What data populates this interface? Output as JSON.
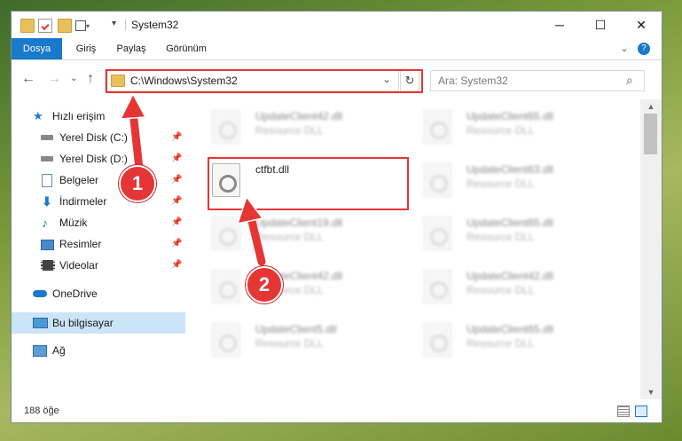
{
  "window": {
    "title": "System32",
    "minimize_icon": "─",
    "maximize_icon": "☐",
    "close_icon": "✕"
  },
  "ribbon": {
    "tabs": [
      "Dosya",
      "Giriş",
      "Paylaş",
      "Görünüm"
    ],
    "expand_icon": "⌄",
    "help_icon": "?"
  },
  "navigation": {
    "back_icon": "←",
    "forward_icon": "→",
    "recent_icon": "⌄",
    "up_icon": "↑",
    "address": "C:\\Windows\\System32",
    "dropdown_icon": "⌄",
    "refresh_icon": "↻",
    "search_placeholder": "Ara: System32",
    "search_icon": "⌕"
  },
  "sidebar": {
    "items": [
      {
        "label": "Hızlı erişim",
        "icon": "star-icon",
        "pinned": false
      },
      {
        "label": "Yerel Disk (C:)",
        "icon": "disk-icon",
        "pinned": true
      },
      {
        "label": "Yerel Disk (D:)",
        "icon": "disk-icon",
        "pinned": true
      },
      {
        "label": "Belgeler",
        "icon": "documents-icon",
        "pinned": true
      },
      {
        "label": "İndirmeler",
        "icon": "download-icon",
        "pinned": true
      },
      {
        "label": "Müzik",
        "icon": "music-icon",
        "pinned": true
      },
      {
        "label": "Resimler",
        "icon": "pictures-icon",
        "pinned": true
      },
      {
        "label": "Videolar",
        "icon": "videos-icon",
        "pinned": true
      },
      {
        "label": "OneDrive",
        "icon": "cloud-icon",
        "pinned": false
      },
      {
        "label": "Bu bilgisayar",
        "icon": "computer-icon",
        "pinned": false,
        "selected": true
      },
      {
        "label": "Ağ",
        "icon": "network-icon",
        "pinned": false
      }
    ],
    "pin_icon": "📌"
  },
  "files": [
    {
      "name": "UpdateClient42.dll",
      "type": "Resource DLL"
    },
    {
      "name": "UpdateClient65.dll",
      "type": "Resource DLL"
    },
    {
      "name": "ctfbt.dll",
      "type": ""
    },
    {
      "name": "UpdateClient63.dll",
      "type": "Resource DLL"
    },
    {
      "name": "UpdateClient19.dll",
      "type": "Resource DLL"
    },
    {
      "name": "UpdateClient65.dll",
      "type": "Resource DLL"
    },
    {
      "name": "UpdateClient42.dll",
      "type": "Resource DLL"
    },
    {
      "name": "UpdateClient42.dll",
      "type": "Resource DLL"
    },
    {
      "name": "UpdateClient5.dll",
      "type": "Resource DLL"
    },
    {
      "name": "UpdateClient65.dll",
      "type": "Resource DLL"
    }
  ],
  "status": {
    "item_count": "188 öğe"
  },
  "callouts": [
    "1",
    "2"
  ],
  "colors": {
    "accent": "#1979ca",
    "highlight": "#e53535",
    "selection": "#cce4f7"
  }
}
